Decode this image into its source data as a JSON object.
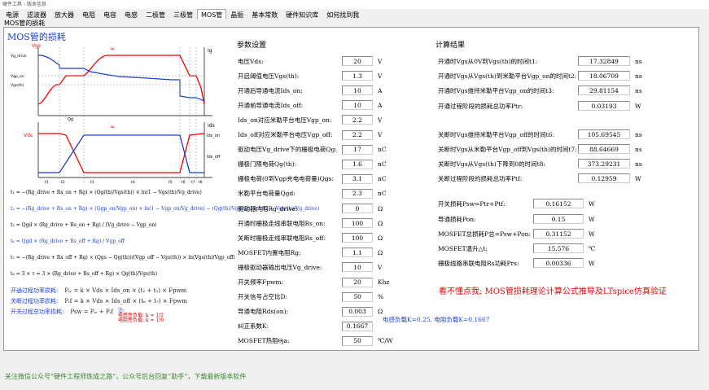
{
  "titlebar": "硬件工具 - 版本信息",
  "tabs": [
    "电源",
    "滤波器",
    "放大器",
    "电阻",
    "电容",
    "电感",
    "二极管",
    "三极管",
    "MOS管",
    "晶振",
    "基本常数",
    "硬件知识库",
    "如何找到我"
  ],
  "active_tab": "MOS管",
  "subcaption": "MOS管的损耗",
  "panel_title": "MOS管的损耗",
  "wave_labels": {
    "ig": "Ig",
    "vgs": "Vgs",
    "vgs_drive": "Vg_drive",
    "vgp_on": "Vgp_on",
    "vgp_off": "Vgp_off",
    "vgs_th": "Vgs(th)",
    "qg": "Qg",
    "ids": "Ids",
    "vds": "Vds",
    "ids_on": "Ids_on",
    "ids_off": "Ids_off",
    "t1": "t1",
    "t2": "t2",
    "t3": "t3",
    "t4": "t4",
    "t5": "t5",
    "t6": "t6",
    "t7": "t7",
    "t8": "t8"
  },
  "formulas": [
    {
      "text": "t₁ = −(Rg_drive + Rs_on + Rg) × (Qg(th)/Vgs(th)) × ln(1 − Vgs(th)/Vg_drive)",
      "color": "black"
    },
    {
      "text": "t₂ = −(Rg_drive + Rs_on + Rg) × (Qgp_on/Vgp_on) × ln(1 − Vgp_on/Vg_drive) − (Qg(th)/Vgs(th)) × ln(1 − Vgs(th)/Vg_drive)",
      "color": "blue"
    },
    {
      "text": "t₃ = Qgd × (Rg_drive + Rs_on + Rg) / (Vg_drive − Vgp_on)",
      "color": "black"
    },
    {
      "text": "t₆ = Qgd × (Rg_drive + Rs_off + Rg) / Vgp_off",
      "color": "blue"
    },
    {
      "text": "t₇ = −(Rg_drive + Rs_off + Rg) × (Qgs − Qg(th))/(Vgp_off − Vgs(th)) × ln(Vgs(th)/Vgp_off)",
      "color": "black"
    },
    {
      "text": "t₈ = 3 × τ = 3 × (Rg_drive + Rs_off + Rg) × Qg(th)/Vgs(th)",
      "color": "black"
    }
  ],
  "loss_lines": [
    {
      "label": "开通过程功率损耗:",
      "expr": "Pₜᵣ = k × Vds × Ids_on × (t₂ + t₃) × Fpwm"
    },
    {
      "label": "关断过程功率损耗:",
      "expr": "Pₜf = k × Vds × Ids_off × (t₆ + t₇) × Fpwm"
    },
    {
      "label": "开关过程总功率损耗:",
      "expr": "Psw = Pₜᵣ + Pₜf"
    }
  ],
  "notes": {
    "title": "注:",
    "cap": "电感性负载:  k = 1/2",
    "ind": "电阻性负载:  k = 1/6",
    "small": "备注: 电感负载损耗"
  },
  "params": {
    "title": "参数设置",
    "rows": [
      {
        "label": "电压Vds:",
        "value": "20",
        "unit": "V"
      },
      {
        "label": "开启阈值电压Vgs(th):",
        "value": "1.3",
        "unit": "V"
      },
      {
        "label": "开通后导通电流Ids_on:",
        "value": "10",
        "unit": "A"
      },
      {
        "label": "开通前导通电流Ids_off:",
        "value": "10",
        "unit": "A"
      },
      {
        "label": "Ids_on对应米勒平台电压Vgp_on:",
        "value": "2.2",
        "unit": "V"
      },
      {
        "label": "Ids_off对应米勒平台电压Vgp_off:",
        "value": "2.2",
        "unit": "V"
      },
      {
        "label": "驱动电压Vg_drive下的栅极电荷Qg:",
        "value": "17",
        "unit": "nC"
      },
      {
        "label": "栅极门限电荷Qg(th):",
        "value": "1.6",
        "unit": "nC"
      },
      {
        "label": "栅极电荷(0到Vgp充电电荷量)Qgs:",
        "value": "3.1",
        "unit": "nC"
      },
      {
        "label": "米勒平台电荷量Qgd:",
        "value": "2.3",
        "unit": "nC"
      },
      {
        "label": "驱动器内阻Rg_drive:",
        "value": "0",
        "unit": "Ω"
      },
      {
        "label": "开通时栅极走线串联电阻Rs_on:",
        "value": "100",
        "unit": "Ω"
      },
      {
        "label": "关断时栅极走线串联电阻Rs_off:",
        "value": "100",
        "unit": "Ω"
      },
      {
        "label": "MOSFET内置电阻Rg:",
        "value": "1.1",
        "unit": "Ω"
      },
      {
        "label": "栅极驱动器输出电压Vg_drive:",
        "value": "10",
        "unit": "V"
      },
      {
        "label": "开关频率Fpwm:",
        "value": "20",
        "unit": "Khz"
      },
      {
        "label": "开关信号占空比D:",
        "value": "50",
        "unit": "%"
      },
      {
        "label": "导通电阻Rds(on):",
        "value": "0.003",
        "unit": "Ω"
      },
      {
        "label": "纠正系数K:",
        "value": "0.1667",
        "unit": ""
      },
      {
        "label": "MOSFET热阻θja:",
        "value": "50",
        "unit": "℃/W"
      }
    ]
  },
  "k_hint": "电感负载K=0.25, 电阻负载K=0.1667",
  "results": {
    "title": "计算结果",
    "group1": [
      {
        "label": "开通时Vgs从0V到Vgs(th)的时间t1:",
        "value": "17.32849",
        "unit": "ns"
      },
      {
        "label": "开通时Vgs从Vgs(th)到米勒平台Vgp_on的时间t2:",
        "value": "18.06709",
        "unit": "ns"
      },
      {
        "label": "开通时Vgs维持米勒平台Vgp_on的时间t3:",
        "value": "29.81154",
        "unit": "ns"
      },
      {
        "label": "开通过程阶段的损耗总功率Ptr:",
        "value": "0.03193",
        "unit": "W"
      }
    ],
    "group2": [
      {
        "label": "关断时Vgs维持米勒平台Vgp_off的时间t6:",
        "value": "105.69545",
        "unit": "ns"
      },
      {
        "label": "关断时Vgs从米勒平台Vgp_off到Vgs(th)的时间t7:",
        "value": "88.64669",
        "unit": "ns"
      },
      {
        "label": "关断时Vgs从Vgs(th)下降到0的时间t8:",
        "value": "373.29231",
        "unit": "ns"
      },
      {
        "label": "关断过程阶段的损耗总功率Ptf:",
        "value": "0.12959",
        "unit": "W"
      }
    ],
    "group3": [
      {
        "label": "开关损耗Psw=Ptr+Ptf:",
        "value": "0.16152",
        "unit": "W"
      },
      {
        "label": "导通损耗Pon:",
        "value": "0.15",
        "unit": "W"
      },
      {
        "label": "MOSFET总损耗P总=Psw+Pon:",
        "value": "0.31152",
        "unit": "W"
      },
      {
        "label": "MOSFET温升△t:",
        "value": "15.576",
        "unit": "℃"
      },
      {
        "label": "栅极线路串联电阻Rs功耗Prs:",
        "value": "0.00336",
        "unit": "W"
      }
    ]
  },
  "compare_link": "看不懂点我: MOS管损耗理论计算公式推导及LTspice仿真验证",
  "footer": "关注微信公众号“硬件工程师炼成之路”，公众号后台回复“助手”，下载最新版本软件",
  "colors": {
    "accent": "#1a3fd6",
    "red": "#e00000",
    "green": "#3a8a2a"
  }
}
